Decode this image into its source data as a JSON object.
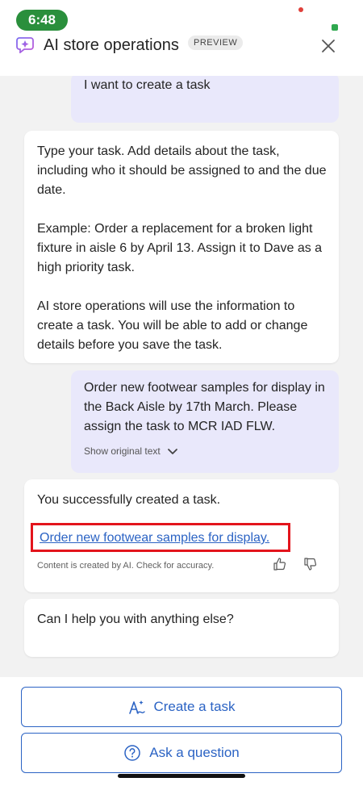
{
  "status_bar": {
    "time": "6:48"
  },
  "header": {
    "title": "AI store operations",
    "badge": "PREVIEW",
    "icon": "copilot-sparkle-icon",
    "close_icon": "close-icon"
  },
  "chat": {
    "user_message_1": "I want to create a task",
    "bot_message_1": {
      "paragraphs": [
        "Type your task. Add details about the task, including who it should be assigned to and the due date.",
        "Example: Order a replacement for a broken light fixture in aisle 6 by April 13. Assign it to Dave as a high priority task.",
        "AI store operations will use the information to create a task. You will be able to add or change details before you save the task."
      ]
    },
    "user_message_2": {
      "text": "Order new footwear samples for display in the Back Aisle by 17th March. Please assign the task to MCR IAD FLW.",
      "show_original": "Show original text"
    },
    "bot_message_2": {
      "text": "You successfully created a task.",
      "task_link": "Order new footwear samples for display.",
      "disclaimer": "Content is created by AI. Check for accuracy."
    },
    "bot_message_3": "Can I help you with anything else?"
  },
  "actions": {
    "create_task": "Create a task",
    "ask_question": "Ask a question"
  },
  "colors": {
    "accent": "#2b63c4",
    "user_bubble": "#e9e8fb",
    "highlight_box": "#e3141c",
    "time_pill": "#2a8f3c"
  }
}
